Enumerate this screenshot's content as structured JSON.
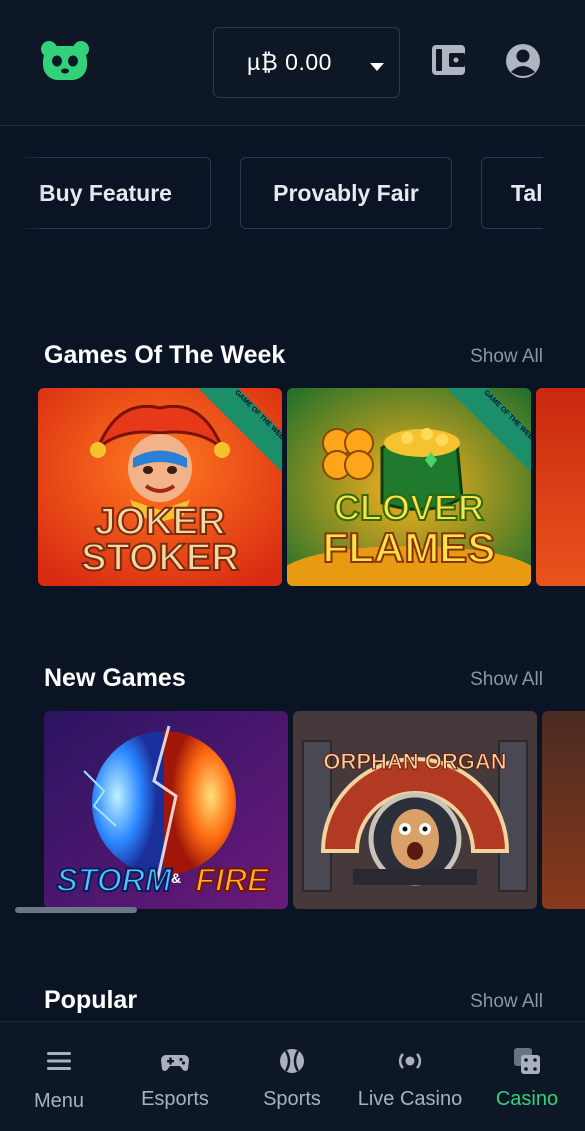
{
  "header": {
    "balance": "µ₿ 0.00",
    "logo_icon": "panda-logo-icon",
    "wallet_icon": "wallet-icon",
    "profile_icon": "user-circle-icon"
  },
  "chips": [
    "Buy Feature",
    "Provably Fair",
    "Tal"
  ],
  "sections": {
    "games_of_week": {
      "title": "Games Of The Week",
      "show_all": "Show All"
    },
    "new_games": {
      "title": "New Games",
      "show_all": "Show All"
    },
    "popular": {
      "title": "Popular",
      "show_all": "Show All"
    }
  },
  "games_of_week": [
    {
      "line1": "JOKER",
      "line2": "STOKER",
      "ribbon": "GAME OF THE WEEK"
    },
    {
      "line1": "CLOVER",
      "line2": "FLAMES",
      "ribbon": "GAME OF THE WEEK"
    }
  ],
  "new_games": [
    {
      "line1": "STORM",
      "mid": "&",
      "line2": "FIRE"
    },
    {
      "line1": "ORPHAN ORGAN"
    }
  ],
  "nav": [
    {
      "label": "Menu",
      "icon": "hamburger-icon"
    },
    {
      "label": "Esports",
      "icon": "gamepad-icon"
    },
    {
      "label": "Sports",
      "icon": "tennis-ball-icon"
    },
    {
      "label": "Live Casino",
      "icon": "live-icon"
    },
    {
      "label": "Casino",
      "icon": "dice-icon"
    }
  ],
  "colors": {
    "background": "#0b1424",
    "accent": "#33d17a",
    "muted_text": "#8a95a5",
    "border": "#2b3a4e"
  }
}
